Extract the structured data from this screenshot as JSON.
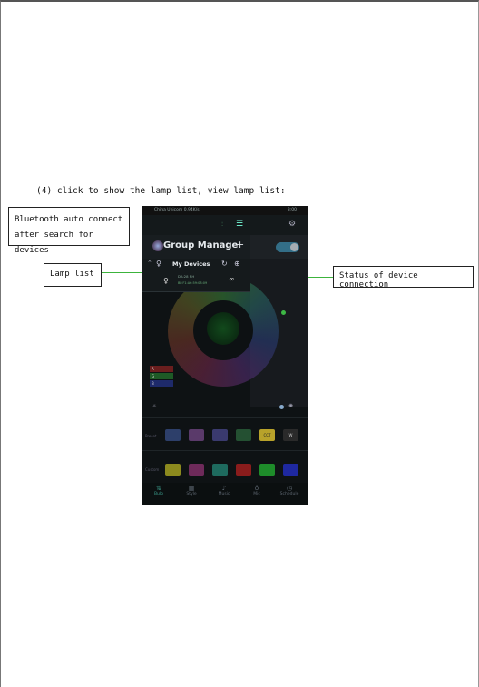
{
  "instruction_text": "(4) click to show the lamp list, view lamp list:",
  "callouts": {
    "bluetooth_line1": "Bluetooth auto connect",
    "bluetooth_line2": "after search for devices",
    "lamp_list": "Lamp list",
    "status": "Status of device connection"
  },
  "phone": {
    "status_left": "China Unicom",
    "status_speed": "0.94K/s",
    "status_time": "3:00",
    "group_manage": "Group Manage",
    "plus": "+",
    "my_devices": "My Devices",
    "device_name": "DA:28 RH",
    "device_mac": "BF:F1:A6:59:08:09",
    "rgb_labels": [
      "R",
      "G",
      "B"
    ],
    "row_preset": "Preset",
    "row_custom": "Custom",
    "preset_cct": "CCT",
    "preset_w": "W",
    "tabs": [
      {
        "label": "Bulb",
        "icon": "bulb-tab-icon"
      },
      {
        "label": "Style",
        "icon": "style-tab-icon"
      },
      {
        "label": "Music",
        "icon": "music-tab-icon"
      },
      {
        "label": "Mic",
        "icon": "mic-tab-icon"
      },
      {
        "label": "Schedule",
        "icon": "schedule-tab-icon"
      }
    ],
    "colors": {
      "accent": "#3a93b5",
      "arrow": "#3cb43c",
      "background": "#0e1214"
    }
  }
}
